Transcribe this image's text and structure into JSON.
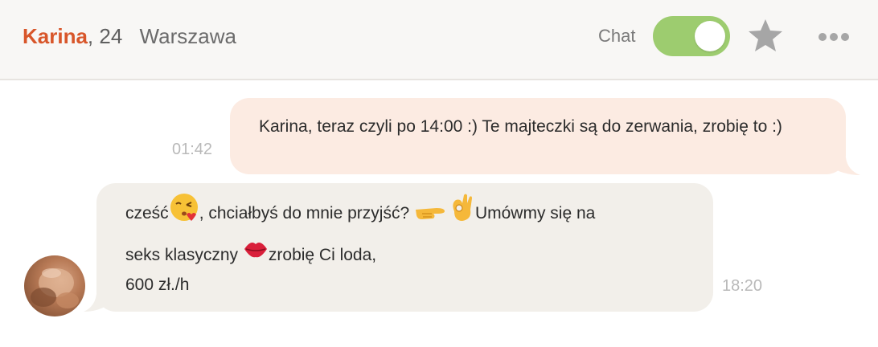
{
  "header": {
    "name": "Karina",
    "separator": ",",
    "age": "24",
    "city": "Warszawa",
    "chat_label": "Chat",
    "chat_enabled": true
  },
  "messages": [
    {
      "direction": "outgoing",
      "text": "Karina, teraz czyli po 14:00 :) Te majteczki są do zerwania, zrobię to :)",
      "time": "01:42"
    },
    {
      "direction": "incoming",
      "line1_a": "cześć",
      "line1_b": ", chciałbyś do mnie przyjść?",
      "line1_c": "Umówmy się na",
      "line2_a": "seks klasyczny",
      "line2_b": "zrobię Ci loda,",
      "line3": "600 zł./h",
      "time": "18:20"
    }
  ],
  "colors": {
    "accent_name": "#d8562a",
    "toggle_on": "#9dcc6f",
    "outgoing_bubble": "#fcebe2",
    "incoming_bubble": "#f2efea"
  },
  "icons": [
    "star-icon",
    "more-options-icon",
    "kissing-face-emoji",
    "pointing-right-emoji",
    "ok-hand-emoji",
    "lips-emoji"
  ]
}
